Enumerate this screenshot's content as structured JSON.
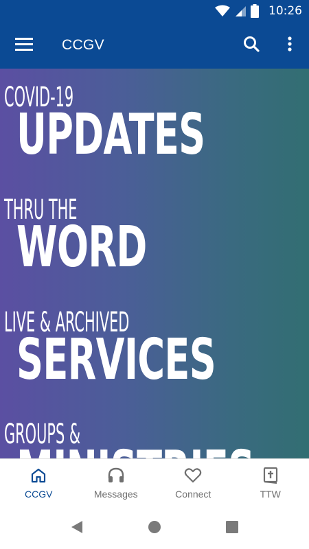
{
  "status_bar": {
    "time": "10:26"
  },
  "app_bar": {
    "title": "CCGV"
  },
  "sections": [
    {
      "kicker": "COVID-19",
      "headline": "UPDATES"
    },
    {
      "kicker": "THRU THE",
      "headline": "WORD"
    },
    {
      "kicker": "LIVE & ARCHIVED",
      "headline": "SERVICES"
    },
    {
      "kicker": "GROUPS &",
      "headline": "MINISTRIES"
    }
  ],
  "bottom_nav": {
    "items": [
      {
        "label": "CCGV",
        "icon": "home-icon",
        "active": true
      },
      {
        "label": "Messages",
        "icon": "headphones-icon",
        "active": false
      },
      {
        "label": "Connect",
        "icon": "heart-icon",
        "active": false
      },
      {
        "label": "TTW",
        "icon": "bible-icon",
        "active": false
      }
    ]
  },
  "colors": {
    "primary": "#0b4a94",
    "gradient_start": "#5b4fa2",
    "gradient_end": "#326e72",
    "nav_inactive": "#6f6f6f"
  }
}
